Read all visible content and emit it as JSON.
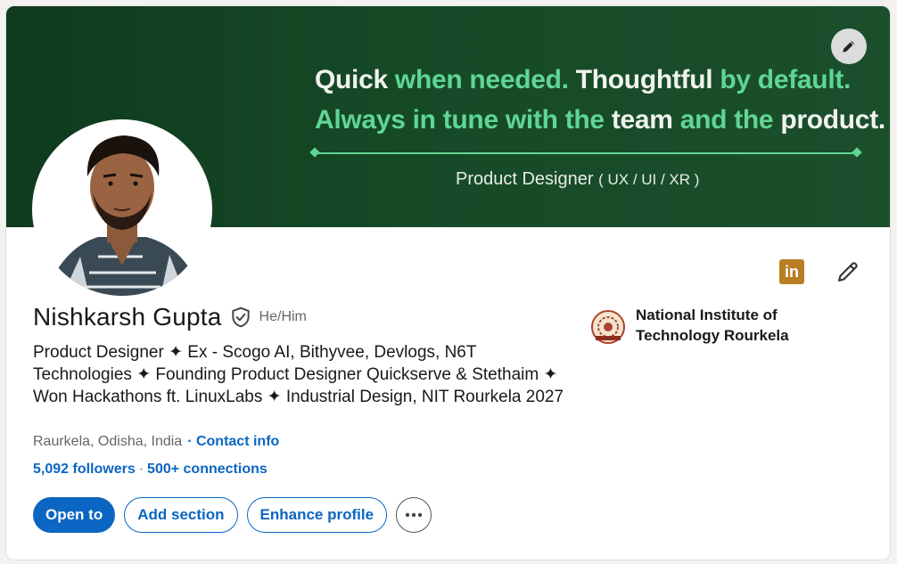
{
  "banner": {
    "line1": [
      "Quick ",
      "when needed. ",
      "Thoughtful ",
      "by default."
    ],
    "line2": [
      "Always in tune with the ",
      "team ",
      "and the ",
      "product."
    ],
    "role": "Product Designer",
    "role_paren": "( UX / UI / XR )"
  },
  "profile": {
    "name": "Nishkarsh Gupta",
    "pronouns": "He/Him",
    "headline": "Product Designer ✦ Ex - Scogo AI, Bithyvee, Devlogs, N6T Technologies ✦ Founding Product Designer Quickserve & Stethaim ✦  Won Hackathons ft. LinuxLabs ✦ Industrial Design, NIT Rourkela 2027",
    "location": "Raurkela, Odisha, India",
    "contact_label": "· Contact info",
    "followers": "5,092 followers",
    "separator": "·",
    "connections": "500+ connections"
  },
  "education": {
    "name": "National Institute of Technology Rourkela"
  },
  "actions": {
    "open_to": "Open to",
    "add_section": "Add section",
    "enhance_profile": "Enhance profile",
    "linkedin_badge": "in"
  },
  "colors": {
    "accent": "#0a66c2",
    "banner_green": "#164a27",
    "banner_highlight": "#5fd694",
    "linkedin_gold": "#b97e24"
  },
  "icons": [
    "banner-edit-icon",
    "avatar",
    "linkedin-icon",
    "edit-pencil-icon",
    "verified-shield-icon",
    "more-options-icon",
    "nit-rourkela-logo"
  ]
}
